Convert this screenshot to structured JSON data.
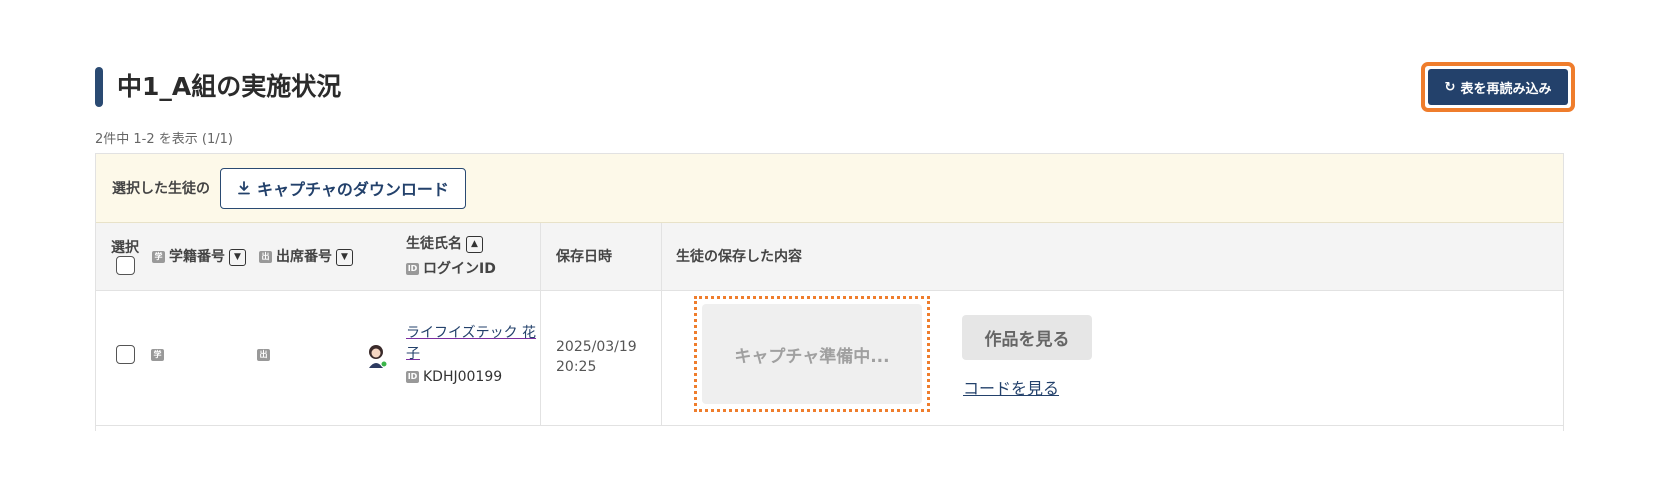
{
  "header": {
    "title": "中1_A組の実施状況",
    "reload_label": "表を再読み込み",
    "reload_icon": "reload-icon"
  },
  "pagination": {
    "summary": "2件中 1-2 を表示 (1/1)"
  },
  "bulk_actions": {
    "label": "選択した生徒の",
    "download_label": "キャプチャのダウンロード",
    "download_icon": "download-icon"
  },
  "table": {
    "columns": {
      "select": "選択",
      "student_number": "学籍番号",
      "attendance_number": "出席番号",
      "student_name": "生徒氏名",
      "login_id": "ログインID",
      "saved_at": "保存日時",
      "saved_content": "生徒の保存した内容"
    },
    "rows": [
      {
        "student_name_line1": "ライフイズテック 花",
        "student_name_line2": "子",
        "login_id": "KDHJ00199",
        "saved_date": "2025/03/19",
        "saved_time": "20:25",
        "capture_status": "キャプチャ準備中...",
        "view_work_label": "作品を見る",
        "view_code_label": "コードを見る"
      }
    ]
  },
  "colors": {
    "primary": "#23416b",
    "highlight": "#ef7d2c",
    "bulk_bar_bg": "#fdf9e9"
  }
}
